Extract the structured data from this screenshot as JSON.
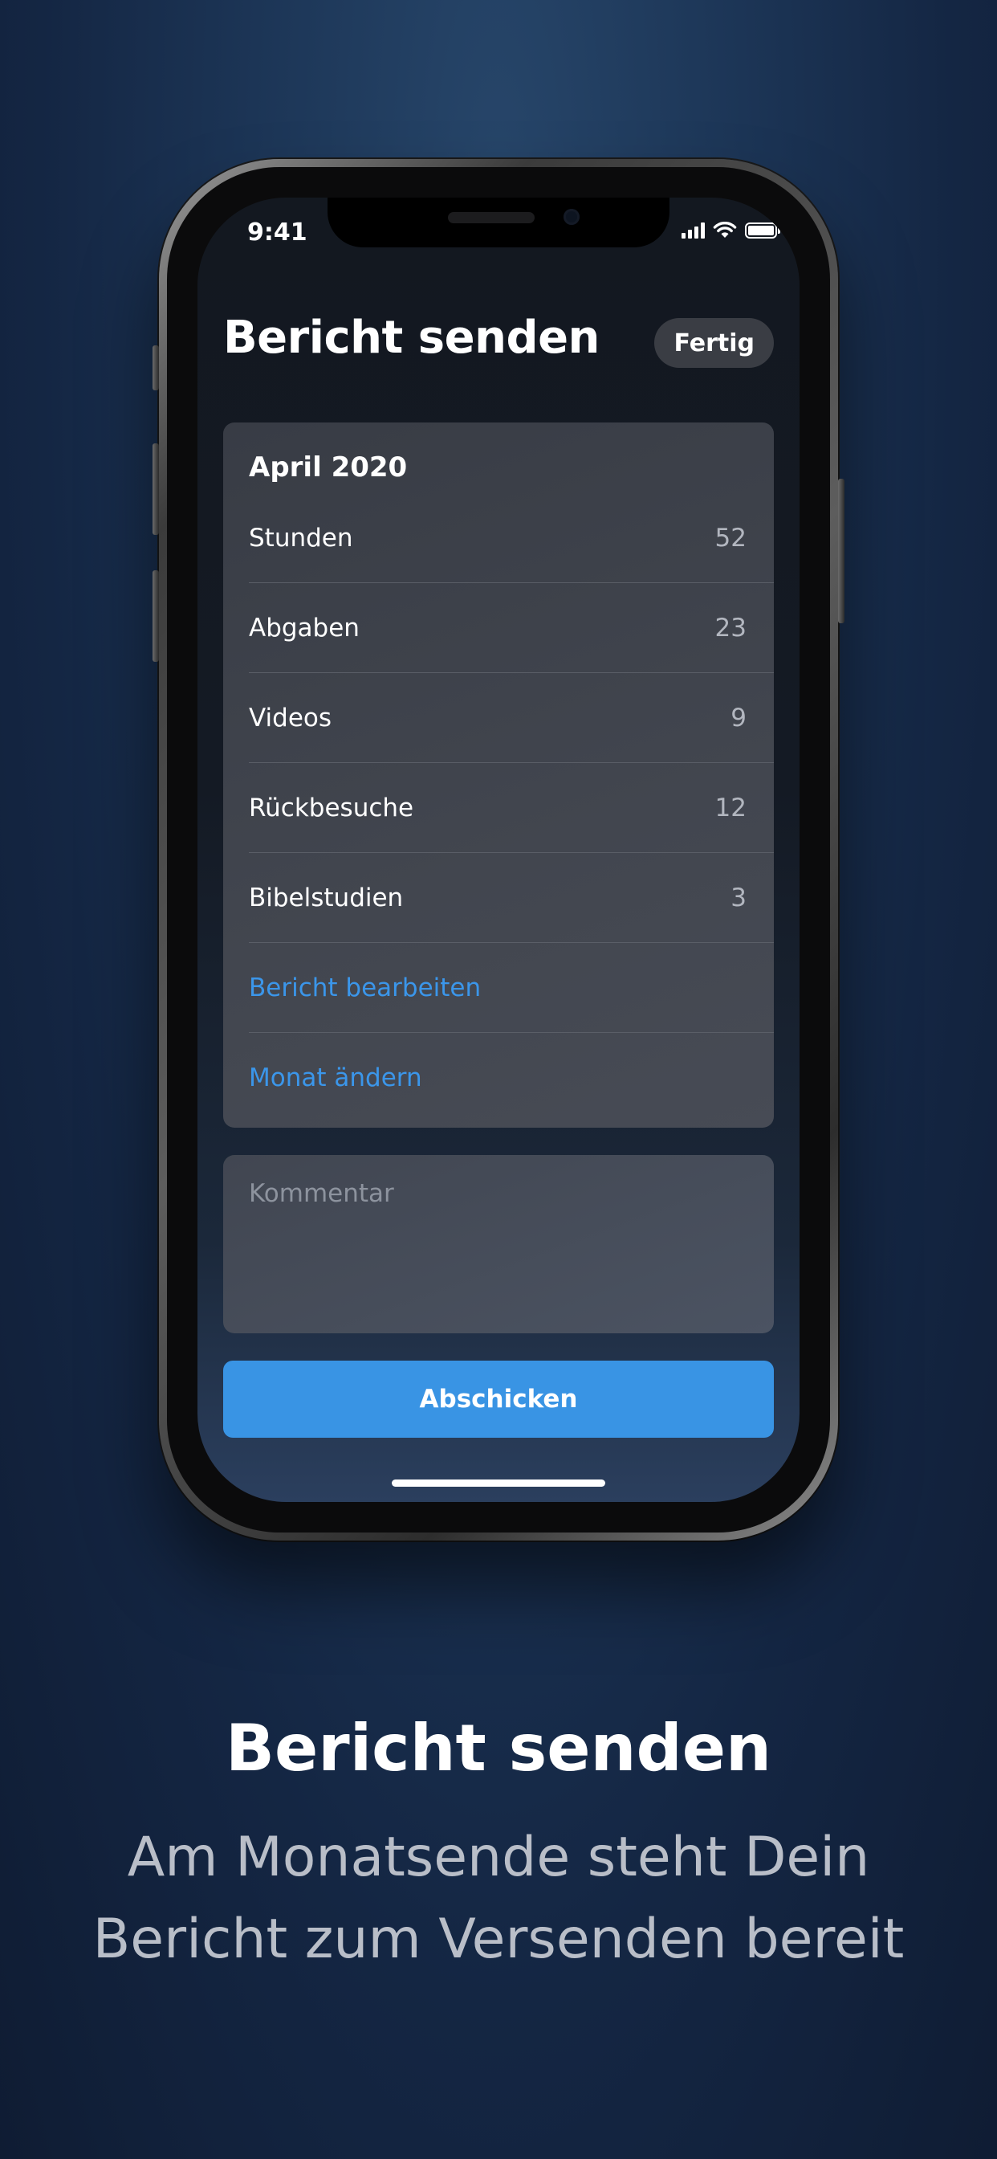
{
  "status_bar": {
    "time": "9:41"
  },
  "header": {
    "title": "Bericht senden",
    "done_label": "Fertig"
  },
  "report": {
    "month": "April 2020",
    "rows": [
      {
        "label": "Stunden",
        "value": "52"
      },
      {
        "label": "Abgaben",
        "value": "23"
      },
      {
        "label": "Videos",
        "value": "9"
      },
      {
        "label": "Rückbesuche",
        "value": "12"
      },
      {
        "label": "Bibelstudien",
        "value": "3"
      }
    ],
    "edit_link": "Bericht bearbeiten",
    "change_month_link": "Monat ändern"
  },
  "comment": {
    "placeholder": "Kommentar"
  },
  "submit_label": "Abschicken",
  "caption": {
    "title": "Bericht senden",
    "subtitle_line1": "Am Monatsende steht Dein",
    "subtitle_line2": "Bericht zum Versenden bereit"
  },
  "colors": {
    "accent": "#3994e4",
    "link": "#3b96ea",
    "background": "#1c3556",
    "card": "#42464f"
  }
}
